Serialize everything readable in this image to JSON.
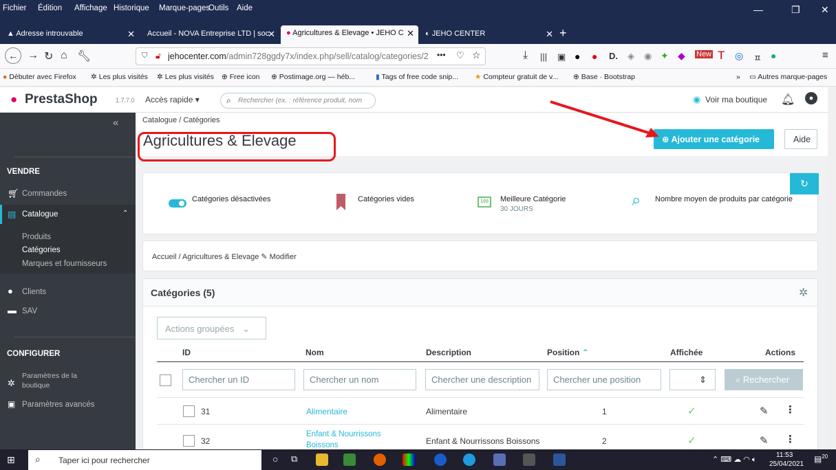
{
  "menubar": {
    "items": [
      "Fichier",
      "Édition",
      "Affichage",
      "Historique",
      "Marque-pages",
      "Outils",
      "Aide"
    ]
  },
  "tabs": [
    {
      "label": "Adresse introuvable"
    },
    {
      "label": "Accueil - NOVA Entreprise LTD | soc"
    },
    {
      "label": "Agricultures & Elevage • JEHO C"
    },
    {
      "label": "JEHO CENTER"
    }
  ],
  "url": {
    "host": "jehocenter.com",
    "path": "/admin728ggdy7x/index.php/sell/catalog/categories/2"
  },
  "bookmarks": [
    "Débuter avec Firefox",
    "Les plus visités",
    "Les plus visités",
    "Free icon",
    "Postimage.org — héb...",
    "Tags of free code snip...",
    "Compteur gratuit de v...",
    "Base · Bootstrap",
    "Autres marque-pages"
  ],
  "header": {
    "logo": "PrestaShop",
    "version": "1.7.7.0",
    "quick_access": "Accès rapide",
    "search_placeholder": "Rechercher (ex. : référence produit, nom",
    "view_shop": "Voir ma boutique"
  },
  "sidebar": {
    "collapse": "«",
    "section_sell": "VENDRE",
    "orders": "Commandes",
    "catalog": "Catalogue",
    "products": "Produits",
    "categories": "Catégories",
    "brands": "Marques et fournisseurs",
    "clients": "Clients",
    "sav": "SAV",
    "section_configure": "CONFIGURER",
    "shop_params_1": "Paramètres de la",
    "shop_params_2": "boutique",
    "advanced": "Paramètres avancés"
  },
  "page": {
    "breadcrumb_1": "Catalogue",
    "breadcrumb_2": "Catégories",
    "title": "Agricultures & Elevage",
    "add_button": "Ajouter une catégorie",
    "help_button": "Aide"
  },
  "kpis": [
    {
      "label": "Catégories désactivées"
    },
    {
      "label": "Catégories vides"
    },
    {
      "label": "Meilleure Catégorie",
      "sub": "30 JOURS"
    },
    {
      "label": "Nombre moyen de produits par catégorie"
    }
  ],
  "crumb": {
    "home": "Accueil",
    "current": "Agricultures & Elevage",
    "edit": "Modifier"
  },
  "table": {
    "title": "Catégories (5)",
    "bulk": "Actions groupées",
    "headers": {
      "id": "ID",
      "name": "Nom",
      "description": "Description",
      "position": "Position",
      "displayed": "Affichée",
      "actions": "Actions"
    },
    "filters": {
      "id": "Chercher un ID",
      "name": "Chercher un nom",
      "description": "Chercher une description",
      "position": "Chercher une position",
      "search": "Rechercher"
    },
    "rows": [
      {
        "id": "31",
        "name": "Alimentaire",
        "description": "Alimentaire",
        "position": "1"
      },
      {
        "id": "32",
        "name_1": "Enfant & Nourrissons",
        "name_2": "Boissons",
        "description": "Enfant & Nourrissons Boissons",
        "position": "2"
      }
    ]
  },
  "taskbar": {
    "search": "Taper ici pour rechercher",
    "time": "11:53",
    "date": "25/04/2021",
    "badge": "20"
  },
  "colors": {
    "accent": "#25b9d7",
    "red_annotation": "#e8161b",
    "sidebar": "#363a41"
  }
}
